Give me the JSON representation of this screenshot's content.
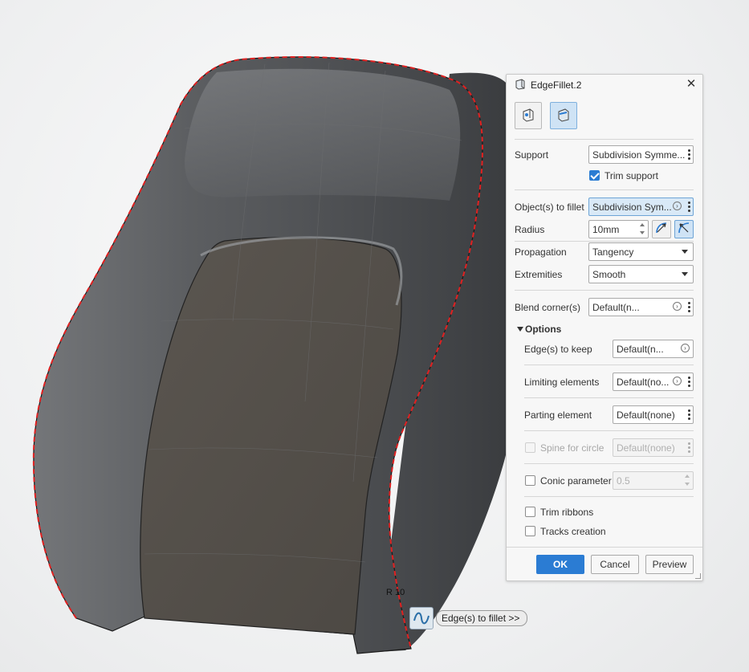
{
  "dialog": {
    "title": "EdgeFillet.2",
    "support_label": "Support",
    "support_value": "Subdivision Symme...",
    "trim_support_label": "Trim support",
    "trim_support_checked": true,
    "objects_label": "Object(s) to fillet",
    "objects_value": "Subdivision Sym...",
    "radius_label": "Radius",
    "radius_value": "10mm",
    "propagation_label": "Propagation",
    "propagation_value": "Tangency",
    "extremities_label": "Extremities",
    "extremities_value": "Smooth",
    "blend_label": "Blend corner(s)",
    "blend_value": "Default(n...",
    "options_label": "Options",
    "edges_keep_label": "Edge(s) to keep",
    "edges_keep_value": "Default(n...",
    "limiting_label": "Limiting elements",
    "limiting_value": "Default(no...",
    "parting_label": "Parting element",
    "parting_value": "Default(none)",
    "spine_label": "Spine for circle",
    "spine_value": "Default(none)",
    "conic_label": "Conic parameter",
    "conic_value": "0.5",
    "trim_ribbons_label": "Trim ribbons",
    "tracks_label": "Tracks creation",
    "ok_label": "OK",
    "cancel_label": "Cancel",
    "preview_label": "Preview"
  },
  "viewport": {
    "radius_tag": "R 10",
    "tooltip": "Edge(s) to fillet >>"
  },
  "colors": {
    "accent": "#2b7cd3",
    "fillet_edge": "#e02020",
    "model": "#5a5b5d"
  }
}
